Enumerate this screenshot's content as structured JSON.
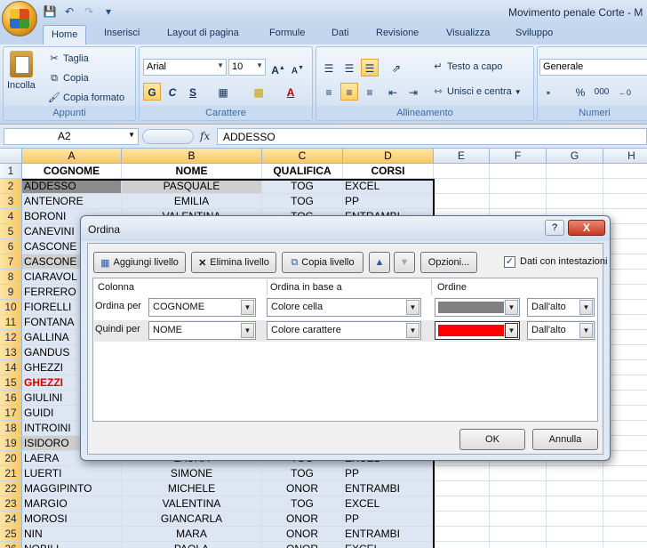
{
  "app": {
    "window_title": "Movimento penale Corte - M"
  },
  "ribbon": {
    "tabs": [
      {
        "label": "Home",
        "active": true
      },
      {
        "label": "Inserisci"
      },
      {
        "label": "Layout di pagina"
      },
      {
        "label": "Formule"
      },
      {
        "label": "Dati"
      },
      {
        "label": "Revisione"
      },
      {
        "label": "Visualizza"
      },
      {
        "label": "Sviluppo"
      }
    ],
    "clipboard": {
      "group_label": "Appunti",
      "paste_label": "Incolla",
      "cut_label": "Taglia",
      "copy_label": "Copia",
      "format_painter_label": "Copia formato"
    },
    "font": {
      "group_label": "Carattere",
      "font_name": "Arial",
      "font_size": "10",
      "bold": "G",
      "italic": "C",
      "underline": "S"
    },
    "alignment": {
      "group_label": "Allineamento",
      "wrap_text_label": "Testo a capo",
      "merge_center_label": "Unisci e centra"
    },
    "number": {
      "group_label": "Numeri",
      "format": "Generale",
      "percent": "%",
      "thousands": "000"
    }
  },
  "formula_bar": {
    "name_box": "A2",
    "fx": "fx",
    "content": "ADDESSO"
  },
  "grid": {
    "columns": [
      "A",
      "B",
      "C",
      "D",
      "E",
      "F",
      "G",
      "H"
    ],
    "rows": [
      {
        "n": "1",
        "a": "COGNOME",
        "b": "NOME",
        "c": "QUALIFICA",
        "d": "CORSI"
      },
      {
        "n": "2",
        "a": "ADDESSO",
        "b": "PASQUALE",
        "c": "TOG",
        "d": "EXCEL"
      },
      {
        "n": "3",
        "a": "ANTENORE",
        "b": "EMILIA",
        "c": "TOG",
        "d": "PP"
      },
      {
        "n": "4",
        "a": "BORONI",
        "b": "VALENTINA",
        "c": "TOG",
        "d": "ENTRAMBI"
      },
      {
        "n": "5",
        "a": "CANEVINI",
        "b": "",
        "c": "",
        "d": ""
      },
      {
        "n": "6",
        "a": "CASCONE",
        "b": "",
        "c": "",
        "d": ""
      },
      {
        "n": "7",
        "a": "CASCONE",
        "b": "",
        "c": "",
        "d": ""
      },
      {
        "n": "8",
        "a": "CIARAVOL",
        "b": "",
        "c": "",
        "d": ""
      },
      {
        "n": "9",
        "a": "FERRERO",
        "b": "",
        "c": "",
        "d": ""
      },
      {
        "n": "10",
        "a": "FIORELLI",
        "b": "",
        "c": "",
        "d": ""
      },
      {
        "n": "11",
        "a": "FONTANA",
        "b": "",
        "c": "",
        "d": ""
      },
      {
        "n": "12",
        "a": "GALLINA",
        "b": "",
        "c": "",
        "d": ""
      },
      {
        "n": "13",
        "a": "GANDUS",
        "b": "",
        "c": "",
        "d": ""
      },
      {
        "n": "14",
        "a": "GHEZZI",
        "b": "",
        "c": "",
        "d": ""
      },
      {
        "n": "15",
        "a": "GHEZZI",
        "b": "",
        "c": "",
        "d": ""
      },
      {
        "n": "16",
        "a": "GIULINI",
        "b": "",
        "c": "",
        "d": ""
      },
      {
        "n": "17",
        "a": "GUIDI",
        "b": "",
        "c": "",
        "d": ""
      },
      {
        "n": "18",
        "a": "INTROINI",
        "b": "",
        "c": "",
        "d": ""
      },
      {
        "n": "19",
        "a": "ISIDORO",
        "b": "",
        "c": "",
        "d": ""
      },
      {
        "n": "20",
        "a": "LAERA",
        "b": "LAURA",
        "c": "TOG",
        "d": "EXCEL"
      },
      {
        "n": "21",
        "a": "LUERTI",
        "b": "SIMONE",
        "c": "TOG",
        "d": "PP"
      },
      {
        "n": "22",
        "a": "MAGGIPINTO",
        "b": "MICHELE",
        "c": "ONOR",
        "d": "ENTRAMBI"
      },
      {
        "n": "23",
        "a": "MARGIO",
        "b": "VALENTINA",
        "c": "TOG",
        "d": "EXCEL"
      },
      {
        "n": "24",
        "a": "MOROSI",
        "b": "GIANCARLA",
        "c": "ONOR",
        "d": "PP"
      },
      {
        "n": "25",
        "a": "NIN",
        "b": "MARA",
        "c": "ONOR",
        "d": "ENTRAMBI"
      },
      {
        "n": "26",
        "a": "NOBILI",
        "b": "PAOLA",
        "c": "ONOR",
        "d": "EXCEL"
      }
    ]
  },
  "dialog": {
    "title": "Ordina",
    "help": "?",
    "close": "X",
    "add_level": "Aggiungi livello",
    "delete_level": "Elimina livello",
    "copy_level": "Copia livello",
    "move_up": "▲",
    "move_down": "▼",
    "options": "Opzioni...",
    "headers_checkbox_label": "Dati con intestazioni",
    "headers_checked": true,
    "table_headers": {
      "column": "Colonna",
      "sort_on": "Ordina in base a",
      "order": "Ordine"
    },
    "levels": [
      {
        "label": "Ordina per",
        "column": "COGNOME",
        "sort_on": "Colore cella",
        "color": "#808080",
        "position": "Dall'alto"
      },
      {
        "label": "Quindi per",
        "column": "NOME",
        "sort_on": "Colore carattere",
        "color": "#ff0000",
        "position": "Dall'alto"
      }
    ],
    "ok": "OK",
    "cancel": "Annulla"
  },
  "colors": {
    "ribbon_bg": "#d4e2f3",
    "selection_highlight": "#ffd064",
    "dark_gray_fill": "#8c8c8c",
    "light_gray_fill": "#cfcfcf",
    "red_text": "#e00000"
  }
}
